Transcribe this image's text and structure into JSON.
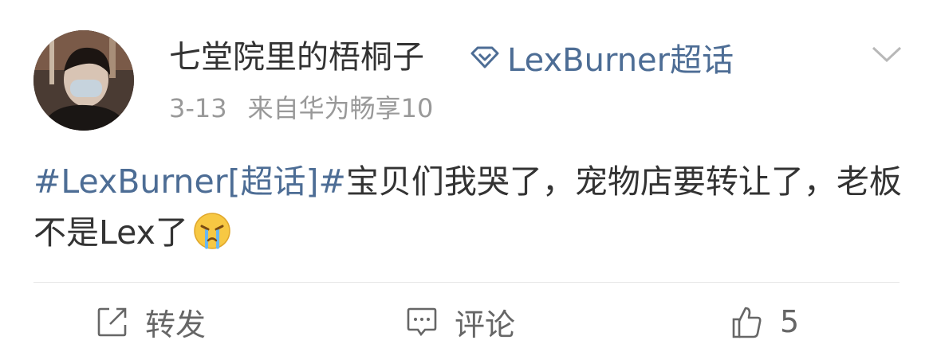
{
  "post": {
    "author": "七堂院里的梧桐子",
    "super_topic": "LexBurner超话",
    "date": "3-13",
    "source": "来自华为畅享10",
    "tag": "#LexBurner[超话]#",
    "text": "宝贝们我哭了，宠物店要转让了，老板不是Lex了",
    "emoji": "crying-face"
  },
  "actions": {
    "repost": "转发",
    "comment": "评论",
    "like_count": "5"
  },
  "colors": {
    "link": "#4d6d95",
    "meta": "#999999",
    "text": "#333333"
  }
}
